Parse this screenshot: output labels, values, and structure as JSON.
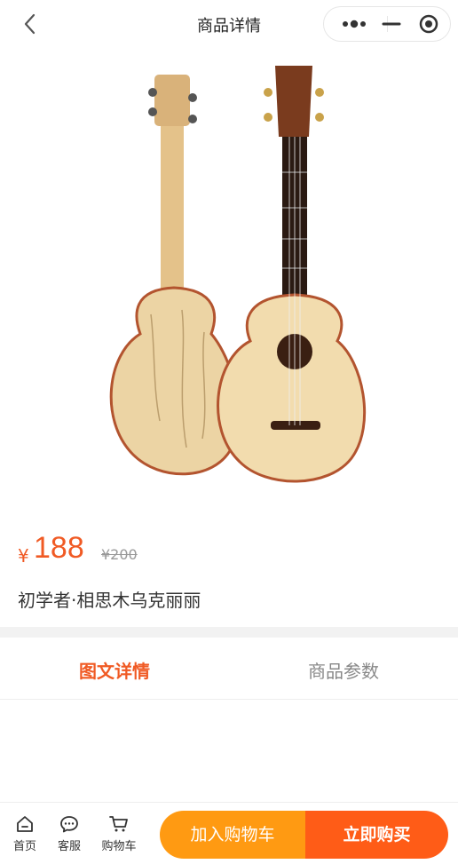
{
  "navbar": {
    "title": "商品详情",
    "back_icon": "chevron-left-icon",
    "more_icon": "more-dots-icon",
    "close_icon": "target-icon"
  },
  "product": {
    "image_alt": "ukulele-product-icon",
    "currency_symbol": "¥",
    "price": "188",
    "original_price": "¥200",
    "name": "初学者·相思木乌克丽丽"
  },
  "tabs": [
    {
      "label": "图文详情",
      "active": true
    },
    {
      "label": "商品参数",
      "active": false
    }
  ],
  "bottom_bar": {
    "home_label": "首页",
    "service_label": "客服",
    "cart_label": "购物车",
    "add_to_cart_label": "加入购物车",
    "buy_now_label": "立即购买"
  },
  "colors": {
    "accent": "#f05a24",
    "add_button": "#ff9a12",
    "buy_button": "#ff5c17"
  }
}
